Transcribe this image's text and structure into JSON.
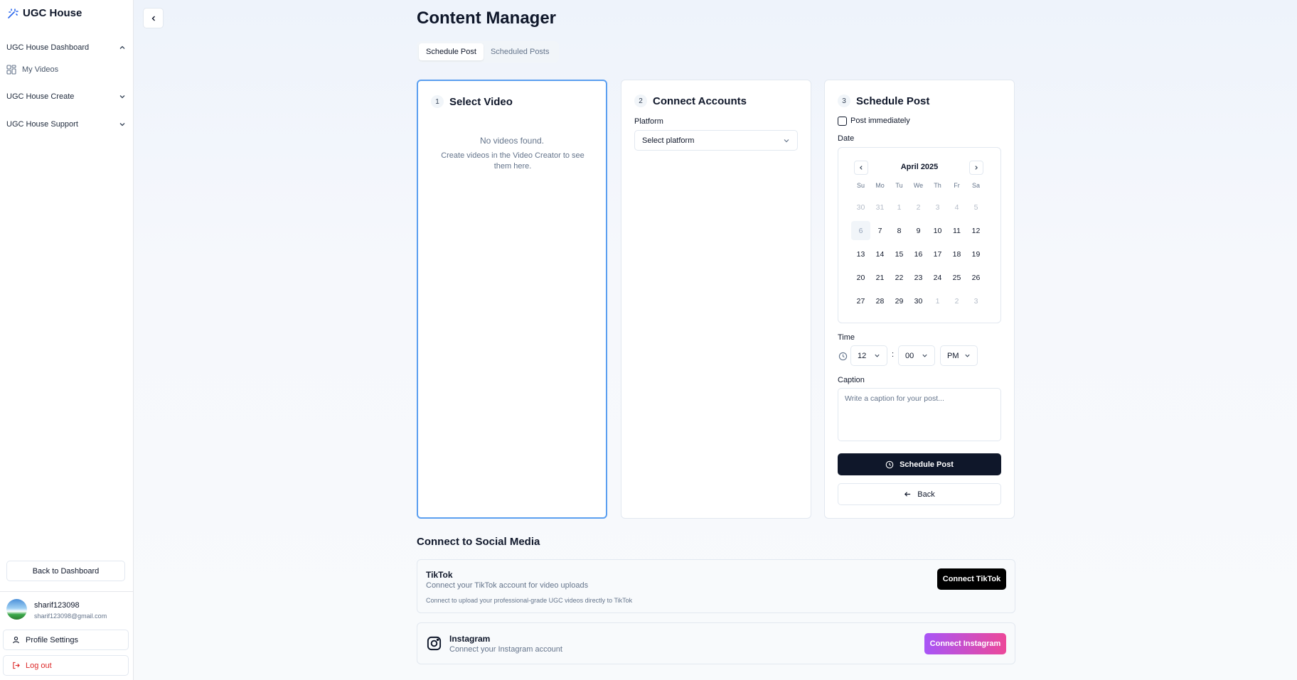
{
  "app": {
    "name": "UGC House"
  },
  "sidebar": {
    "groups": [
      {
        "label": "UGC House Dashboard",
        "expanded": true,
        "items": [
          {
            "label": "My Videos",
            "icon": "grid-icon"
          }
        ]
      },
      {
        "label": "UGC House Create",
        "expanded": false
      },
      {
        "label": "UGC House Support",
        "expanded": false
      }
    ],
    "back_to_dashboard": "Back to Dashboard",
    "user": {
      "name": "sharif123098",
      "email": "sharif123098@gmail.com"
    },
    "profile_settings": "Profile Settings",
    "logout": "Log out"
  },
  "main": {
    "title": "Content Manager",
    "tabs": [
      {
        "label": "Schedule Post",
        "active": true
      },
      {
        "label": "Scheduled Posts",
        "active": false
      }
    ],
    "steps": {
      "select_video": {
        "num": "1",
        "title": "Select Video",
        "empty_title": "No videos found.",
        "empty_desc": "Create videos in the Video Creator to see them here."
      },
      "connect_accounts": {
        "num": "2",
        "title": "Connect Accounts",
        "platform_label": "Platform",
        "platform_value": "Select platform"
      },
      "schedule_post": {
        "num": "3",
        "title": "Schedule Post",
        "post_immediately": "Post immediately",
        "date_label": "Date",
        "calendar": {
          "month": "April 2025",
          "dow": [
            "Su",
            "Mo",
            "Tu",
            "We",
            "Th",
            "Fr",
            "Sa"
          ],
          "weeks": [
            [
              "30",
              "31",
              "1",
              "2",
              "3",
              "4",
              "5"
            ],
            [
              "6",
              "7",
              "8",
              "9",
              "10",
              "11",
              "12"
            ],
            [
              "13",
              "14",
              "15",
              "16",
              "17",
              "18",
              "19"
            ],
            [
              "20",
              "21",
              "22",
              "23",
              "24",
              "25",
              "26"
            ],
            [
              "27",
              "28",
              "29",
              "30",
              "1",
              "2",
              "3"
            ]
          ]
        },
        "time_label": "Time",
        "hour": "12",
        "minute": "00",
        "separator": ":",
        "period": "PM",
        "caption_label": "Caption",
        "caption_placeholder": "Write a caption for your post...",
        "schedule_button": "Schedule Post",
        "back_button": "Back"
      }
    },
    "social": {
      "title": "Connect to Social Media",
      "tiktok": {
        "name": "TikTok",
        "desc": "Connect your TikTok account for video uploads",
        "note": "Connect to upload your professional-grade UGC videos directly to TikTok",
        "button": "Connect TikTok"
      },
      "instagram": {
        "name": "Instagram",
        "desc": "Connect your Instagram account",
        "button": "Connect Instagram"
      }
    }
  },
  "colors": {
    "accent_border": "#5b9ff0",
    "primary": "#0f172a",
    "instagram_gradient_start": "#a855f7",
    "instagram_gradient_end": "#ec4899",
    "logout": "#dc2626"
  }
}
